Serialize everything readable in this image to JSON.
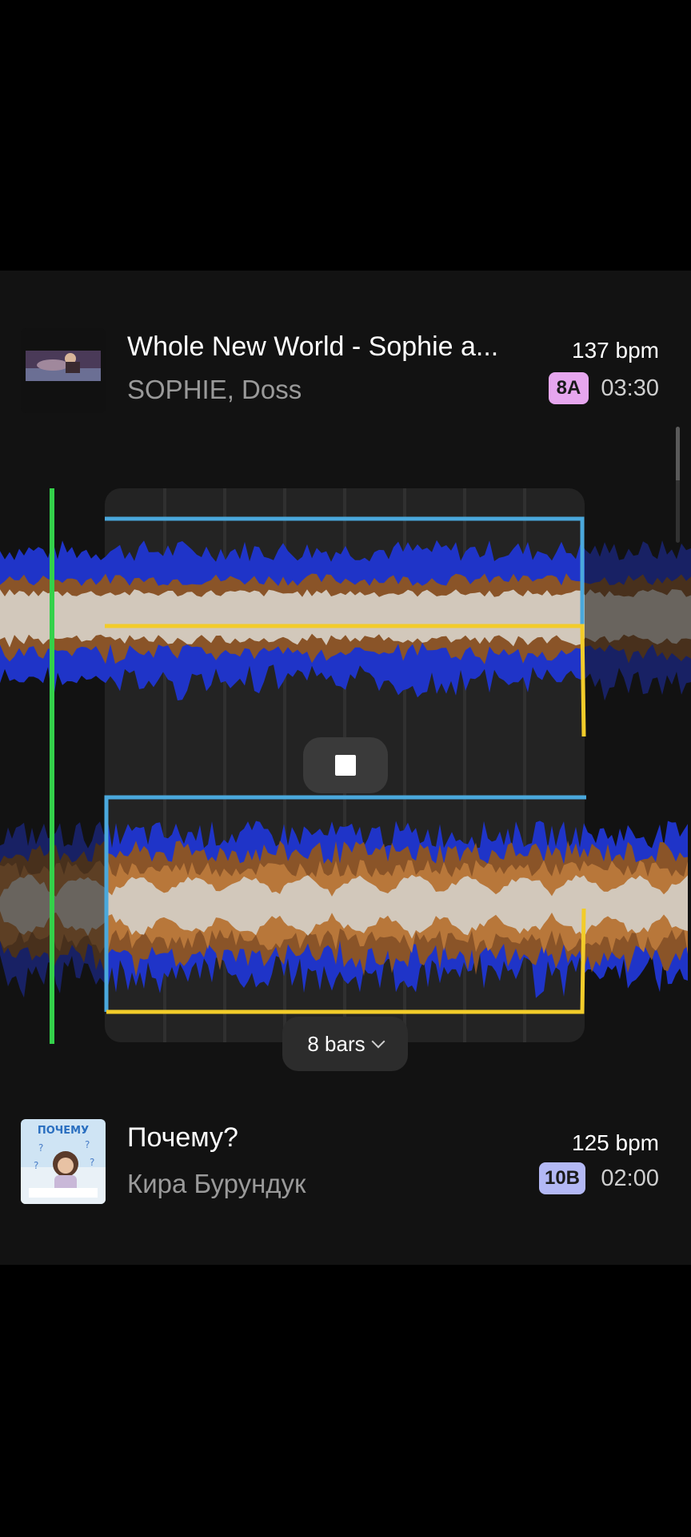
{
  "colors": {
    "background": "#000000",
    "panel": "#121212",
    "playhead": "#34d14a",
    "loop_top": "#4aa8dc",
    "loop_bottom": "#f2cc2a",
    "wave_low": "#1f34c8",
    "wave_mid_top": "#8a5428",
    "wave_mid_bottom": "#b8773a",
    "wave_high": "#d2c8bb"
  },
  "tracks": [
    {
      "title": "Whole New World - Sophie a...",
      "artist": "SOPHIE, Doss",
      "bpm": "137 bpm",
      "key": "8A",
      "key_color": "#e6a6ee",
      "duration": "03:30",
      "artwork_icon": "album-art-whole-new-world"
    },
    {
      "title": "Почему?",
      "artist": "Кира Бурундук",
      "bpm": "125 bpm",
      "key": "10B",
      "key_color": "#b3b8f5",
      "duration": "02:00",
      "artwork_icon": "album-art-pochemu",
      "artwork_text": "ПОЧЕМУ"
    }
  ],
  "transition": {
    "stop_icon": "stop-icon",
    "loop_length_label": "8 bars",
    "loop_length_icon": "chevron-down-icon"
  }
}
